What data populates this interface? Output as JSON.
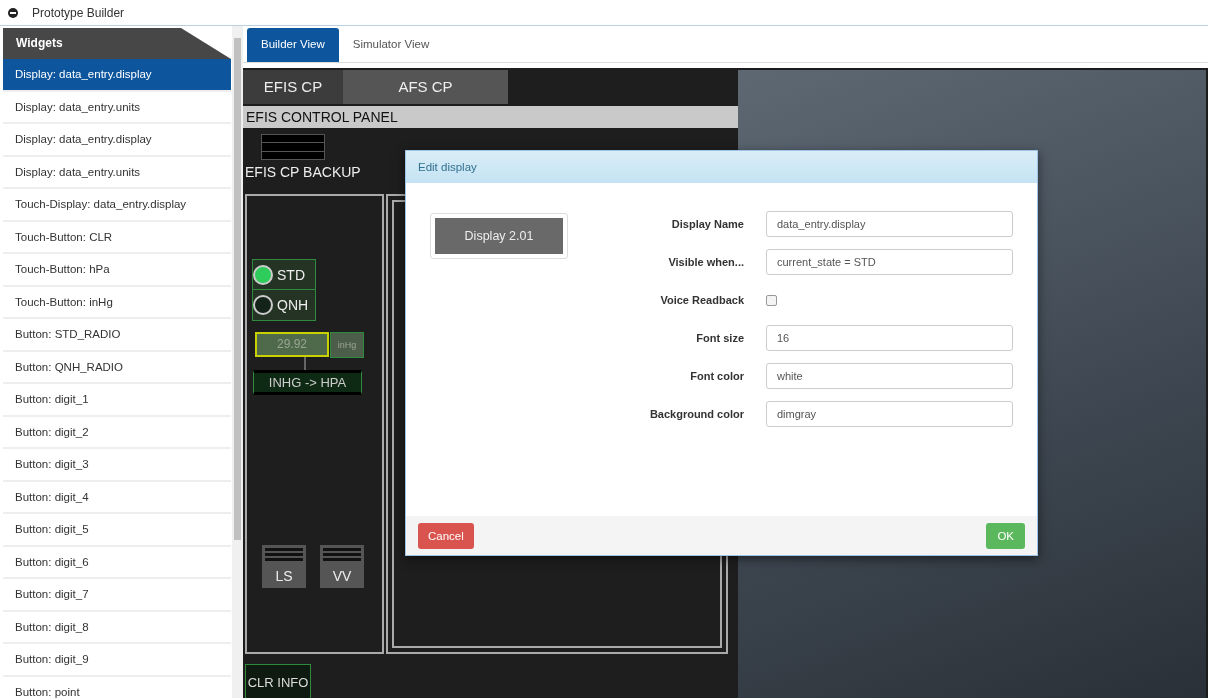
{
  "window": {
    "title": "Prototype Builder"
  },
  "sidebar": {
    "header": "Widgets",
    "items": [
      {
        "label": "Display: data_entry.display",
        "selected": true
      },
      {
        "label": "Display: data_entry.units",
        "selected": false
      },
      {
        "label": "Display: data_entry.display",
        "selected": false
      },
      {
        "label": "Display: data_entry.units",
        "selected": false
      },
      {
        "label": "Touch-Display: data_entry.display",
        "selected": false
      },
      {
        "label": "Touch-Button: CLR",
        "selected": false
      },
      {
        "label": "Touch-Button: hPa",
        "selected": false
      },
      {
        "label": "Touch-Button: inHg",
        "selected": false
      },
      {
        "label": "Button: STD_RADIO",
        "selected": false
      },
      {
        "label": "Button: QNH_RADIO",
        "selected": false
      },
      {
        "label": "Button: digit_1",
        "selected": false
      },
      {
        "label": "Button: digit_2",
        "selected": false
      },
      {
        "label": "Button: digit_3",
        "selected": false
      },
      {
        "label": "Button: digit_4",
        "selected": false
      },
      {
        "label": "Button: digit_5",
        "selected": false
      },
      {
        "label": "Button: digit_6",
        "selected": false
      },
      {
        "label": "Button: digit_7",
        "selected": false
      },
      {
        "label": "Button: digit_8",
        "selected": false
      },
      {
        "label": "Button: digit_9",
        "selected": false
      },
      {
        "label": "Button: point",
        "selected": false
      }
    ]
  },
  "tabs": [
    {
      "label": "Builder View",
      "selected": true
    },
    {
      "label": "Simulator View",
      "selected": false
    }
  ],
  "canvas": {
    "panel_tabs": [
      {
        "label": "EFIS CP",
        "selected": true
      },
      {
        "label": "AFS CP",
        "selected": false
      }
    ],
    "panel_title": "EFIS CONTROL PANEL",
    "backup_label": "EFIS CP BACKUP",
    "baro_mode": [
      {
        "label": "STD",
        "selected": true
      },
      {
        "label": "QNH",
        "selected": false
      }
    ],
    "baro_display": "29.92",
    "baro_units": "inHg",
    "convert_button": "INHG -> HPA",
    "buttons": [
      "LS",
      "VV"
    ],
    "clr_info": "CLR INFO"
  },
  "dialog": {
    "title": "Edit display",
    "preview": "Display 2.01",
    "fields": [
      {
        "kind": "text",
        "label": "Display Name",
        "value": "data_entry.display"
      },
      {
        "kind": "text",
        "label": "Visible when...",
        "value": "current_state = STD"
      },
      {
        "kind": "checkbox",
        "label": "Voice Readback",
        "checked": false
      },
      {
        "kind": "text",
        "label": "Font size",
        "value": "16"
      },
      {
        "kind": "text",
        "label": "Font color",
        "value": "white"
      },
      {
        "kind": "text",
        "label": "Background color",
        "value": "dimgray"
      }
    ],
    "cancel": "Cancel",
    "ok": "OK"
  }
}
